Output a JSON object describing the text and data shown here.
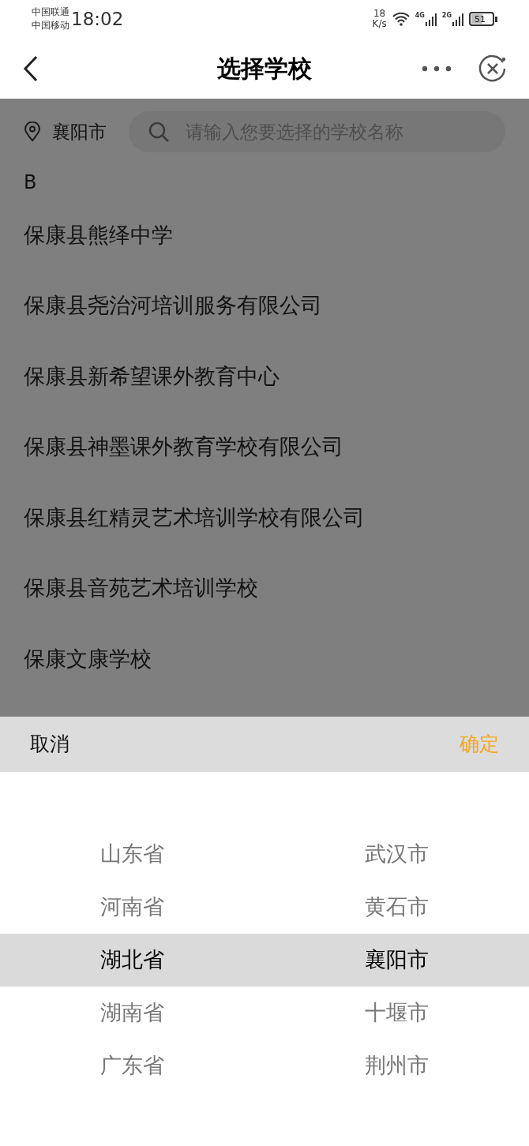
{
  "status_bar": {
    "carriers": [
      "中国联通",
      "中国移动"
    ],
    "time": "18:02",
    "net_speed": [
      "18",
      "K/s"
    ],
    "signals": [
      "4G",
      "2G"
    ],
    "battery": "51"
  },
  "nav": {
    "title": "选择学校"
  },
  "location": {
    "city": "襄阳市"
  },
  "search": {
    "placeholder": "请输入您要选择的学校名称"
  },
  "section": {
    "letter": "B",
    "schools": [
      "保康县熊绎中学",
      "保康县尧治河培训服务有限公司",
      "保康县新希望课外教育中心",
      "保康县神墨课外教育学校有限公司",
      "保康县红精灵艺术培训学校有限公司",
      "保康县音苑艺术培训学校",
      "保康文康学校"
    ]
  },
  "picker": {
    "cancel": "取消",
    "confirm": "确定",
    "provinces": [
      {
        "label": "山东省",
        "selected": false
      },
      {
        "label": "河南省",
        "selected": false
      },
      {
        "label": "湖北省",
        "selected": true
      },
      {
        "label": "湖南省",
        "selected": false
      },
      {
        "label": "广东省",
        "selected": false
      }
    ],
    "cities": [
      {
        "label": "武汉市",
        "selected": false
      },
      {
        "label": "黄石市",
        "selected": false
      },
      {
        "label": "襄阳市",
        "selected": true
      },
      {
        "label": "十堰市",
        "selected": false
      },
      {
        "label": "荆州市",
        "selected": false
      }
    ]
  }
}
